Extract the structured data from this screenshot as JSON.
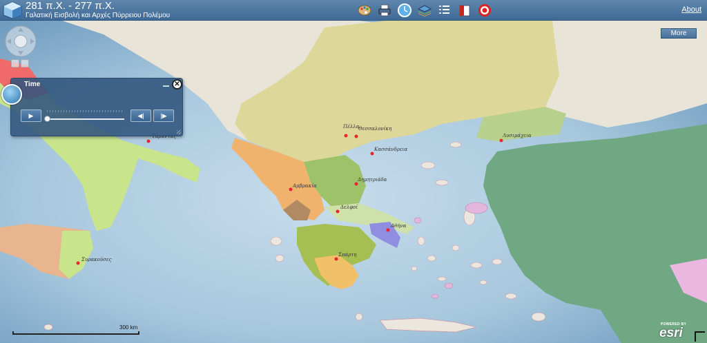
{
  "header": {
    "title": "281 π.Χ. - 277 π.Χ.",
    "subtitle": "Γαλατική Εισβολή και  Αρχές Πύρρειου Πολέμου",
    "about_label": "About",
    "tools": [
      "palette-icon",
      "print-icon",
      "time-slider-icon",
      "layers-icon",
      "legend-icon",
      "bookmark-icon",
      "target-icon"
    ]
  },
  "map": {
    "more_label": "More",
    "scale_label": "300 km",
    "attribution_small": "POWERED BY",
    "attribution_logo": "esri",
    "cities": [
      {
        "name": "Πέλλα"
      },
      {
        "name": "Θεσσαλονίκη"
      },
      {
        "name": "Κασσάνδρεια"
      },
      {
        "name": "Λυσιμάχεια"
      },
      {
        "name": "Δημητριάδα"
      },
      {
        "name": "Αμβρακία"
      },
      {
        "name": "Δελφοί"
      },
      {
        "name": "Αθήνα"
      },
      {
        "name": "Σπάρτη"
      },
      {
        "name": "Συρακούσες"
      },
      {
        "name": "Τάραντας"
      }
    ],
    "colors": {
      "sea": "#9dbfd6",
      "thrace_macedonia": "#ddd79a",
      "epirus": "#f0b36e",
      "thessaly": "#9ec26a",
      "peloponnese": "#a5bf52",
      "sparta": "#f1c16a",
      "athens": "#8f8ee0",
      "asia_minor": "#6fa883",
      "italy": "#c8e58c",
      "carthage_sicily": "#e8b58e"
    }
  },
  "time_panel": {
    "title": "Time",
    "play_symbol": "▶",
    "prev_symbol": "◀|",
    "next_symbol": "|▶",
    "close_symbol": "✕",
    "slider_position": 0
  }
}
